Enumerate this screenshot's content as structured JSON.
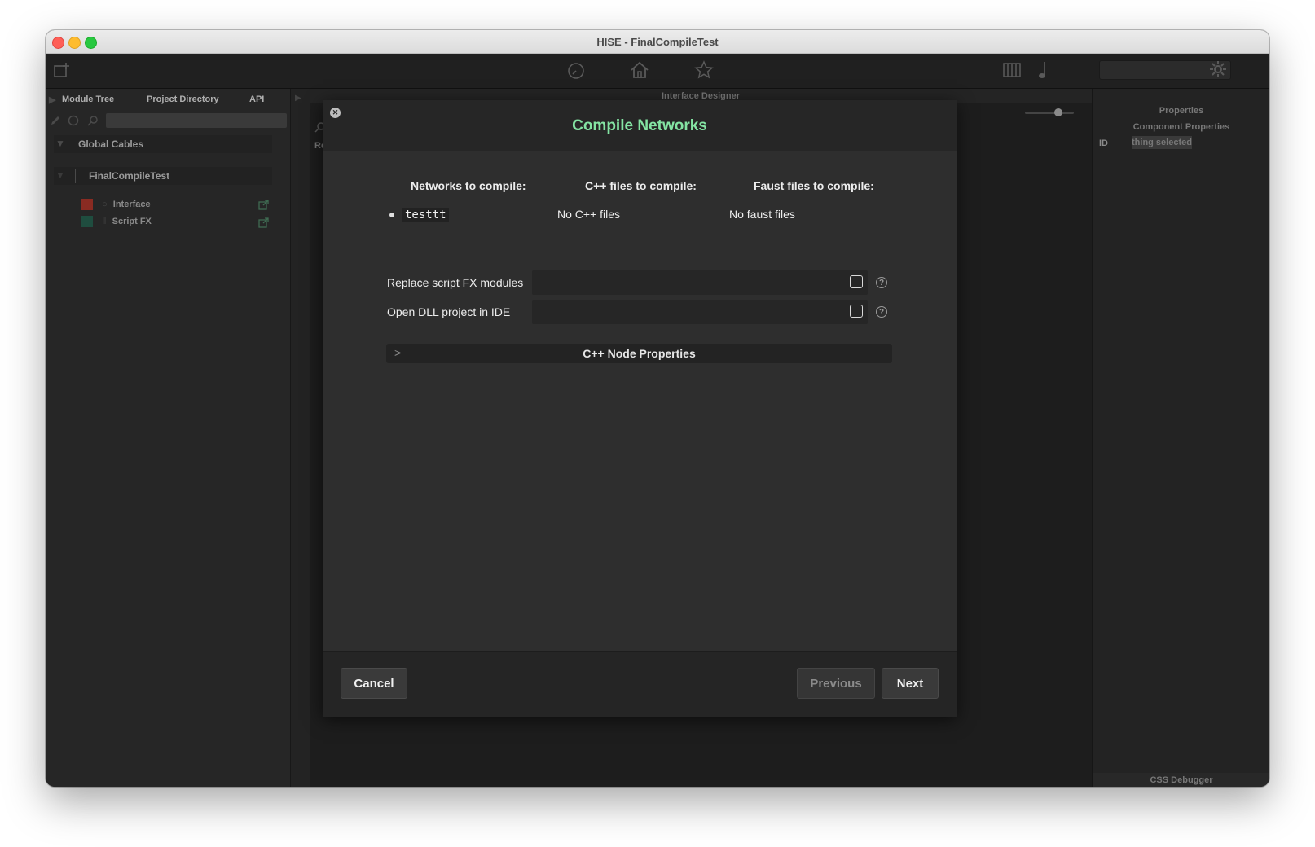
{
  "window": {
    "title": "HISE - FinalCompileTest"
  },
  "left_panel": {
    "tabs": [
      "Module Tree",
      "Project Directory",
      "API"
    ],
    "global_cables_label": "Global Cables",
    "root_label": "FinalCompileTest",
    "items": [
      {
        "label": "Interface",
        "color": "#8a2b22"
      },
      {
        "label": "Script FX",
        "color": "#1f4d3f"
      }
    ]
  },
  "center": {
    "header": "Interface Designer",
    "partial_label": "Re"
  },
  "right_panel": {
    "header": "Properties",
    "sub_header": "Component Properties",
    "id_label": "ID",
    "id_value": "thing selected",
    "footer": "CSS Debugger"
  },
  "dialog": {
    "title": "Compile Networks",
    "columns": {
      "networks": {
        "heading": "Networks to compile:",
        "items": [
          "testtt"
        ]
      },
      "cpp": {
        "heading": "C++ files to compile:",
        "value": "No C++ files"
      },
      "faust": {
        "heading": "Faust files to compile:",
        "value": "No faust files"
      }
    },
    "options": [
      {
        "label": "Replace script FX modules",
        "checked": false
      },
      {
        "label": "Open DLL project in IDE",
        "checked": false
      }
    ],
    "section": {
      "label": "C++ Node Properties"
    },
    "buttons": {
      "cancel": "Cancel",
      "previous": "Previous",
      "next": "Next"
    }
  },
  "colors": {
    "accent": "#84e4a3"
  }
}
